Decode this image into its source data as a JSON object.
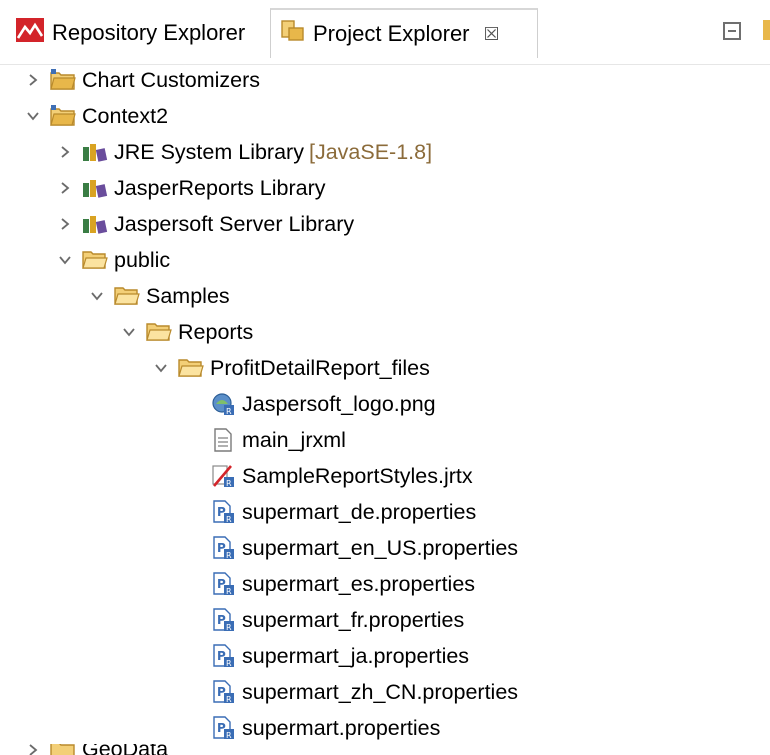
{
  "tabs": {
    "repository_explorer": "Repository Explorer",
    "project_explorer": "Project Explorer",
    "close_glyph": "☒"
  },
  "tree": {
    "chart_customizers": "Chart Customizers",
    "context2": "Context2",
    "jre_library": "JRE System Library",
    "jre_decoration": "[JavaSE-1.8]",
    "jasperreports_library": "JasperReports Library",
    "jaspersoft_server_library": "Jaspersoft Server Library",
    "public": "public",
    "samples": "Samples",
    "reports": "Reports",
    "profit_detail_files": "ProfitDetailReport_files",
    "files": [
      "Jaspersoft_logo.png",
      "main_jrxml",
      "SampleReportStyles.jrtx",
      "supermart_de.properties",
      "supermart_en_US.properties",
      "supermart_es.properties",
      "supermart_fr.properties",
      "supermart_ja.properties",
      "supermart_zh_CN.properties",
      "supermart.properties"
    ],
    "next_project_partial": "GeoData"
  },
  "colors": {
    "folder": "#e8b74a",
    "folder_open": "#f3cf77",
    "jaspersoft_red": "#d3242a",
    "twisty": "#6b6b6b",
    "decoration": "#8b6b3a"
  }
}
